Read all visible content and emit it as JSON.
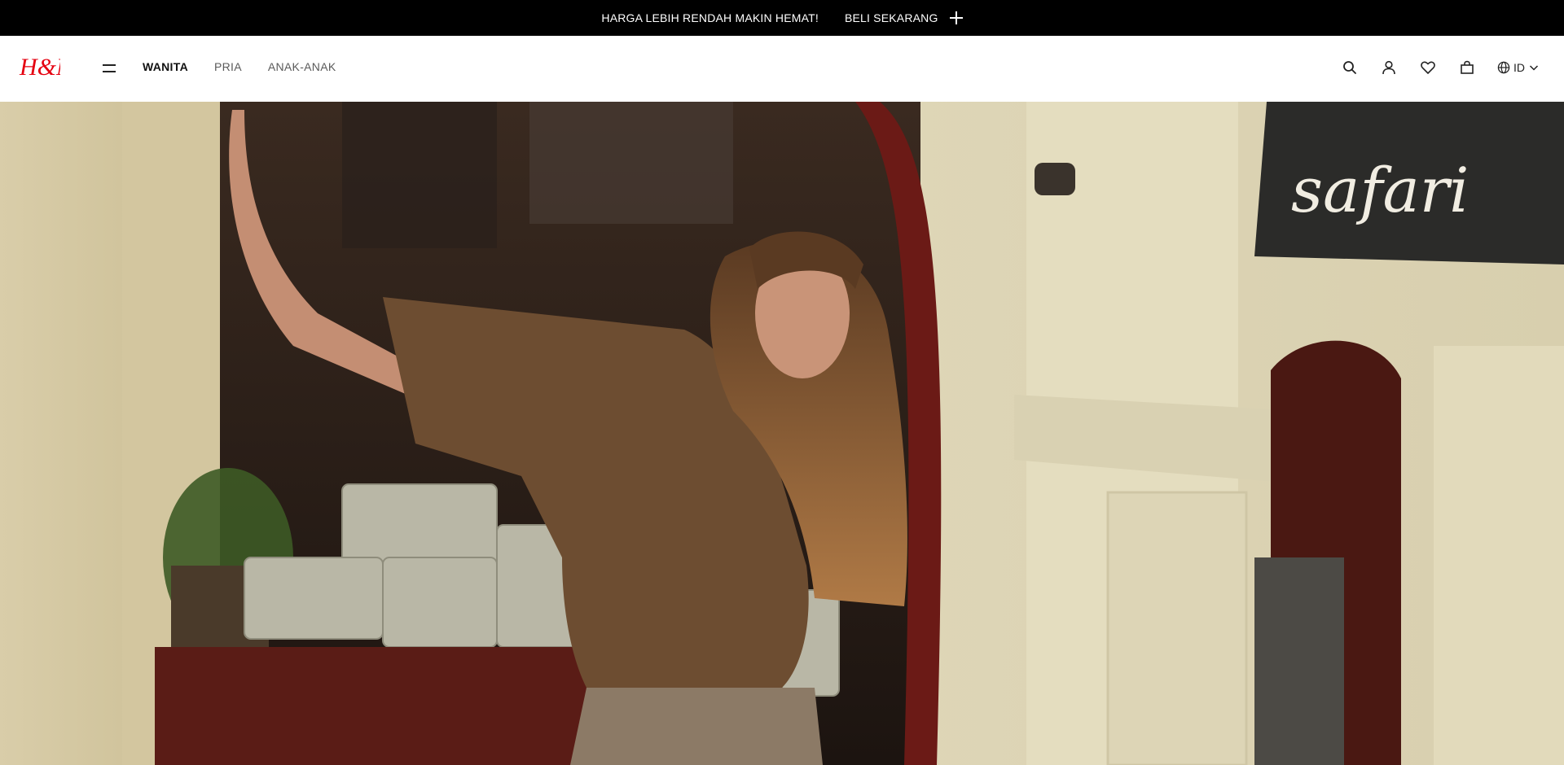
{
  "promo": {
    "message": "HARGA LEBIH RENDAH MAKIN HEMAT!",
    "cta_label": "BELI SEKARANG"
  },
  "brand": {
    "logo_text": "H&M",
    "logo_color": "#e50010"
  },
  "nav": {
    "items": [
      {
        "label": "WANITA",
        "active": true
      },
      {
        "label": "PRIA",
        "active": false
      },
      {
        "label": "ANAK-ANAK",
        "active": false
      }
    ]
  },
  "tools": {
    "icons": [
      "search-icon",
      "account-icon",
      "heart-icon",
      "bag-icon",
      "globe-icon"
    ],
    "locale_label": "ID"
  },
  "hero": {
    "sign_text": "safari"
  }
}
